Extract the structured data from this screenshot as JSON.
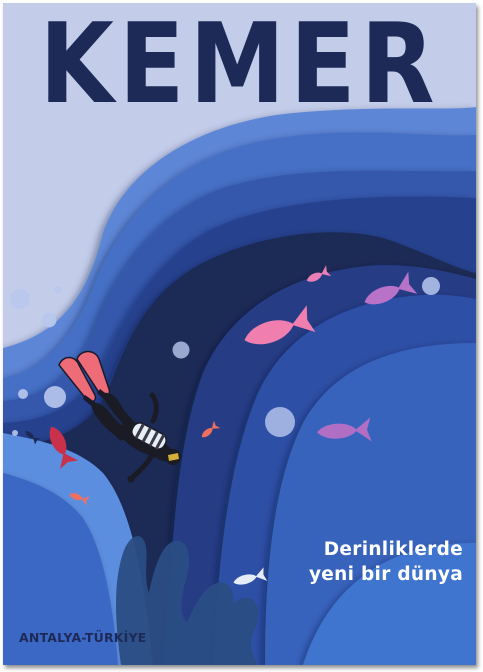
{
  "poster": {
    "title": "KEMER",
    "tagline_line1": "Derinliklerde",
    "tagline_line2": "yeni bir dünya",
    "location": "ANTALYA-TÜRKİYE"
  },
  "colors": {
    "background": "#c3cdea",
    "title": "#1d2a57",
    "ocean_deep": "#1d2a57",
    "ocean_mid": "#2d4a9c",
    "ocean_light": "#3e6fc4",
    "fish_pink": "#f07fb0",
    "fish_purple": "#b873c8",
    "fish_red": "#d44848",
    "fins": "#ee6b78"
  },
  "icons": [
    "diver-illustration",
    "fish-icon",
    "bubble-icon",
    "coral-icon"
  ]
}
